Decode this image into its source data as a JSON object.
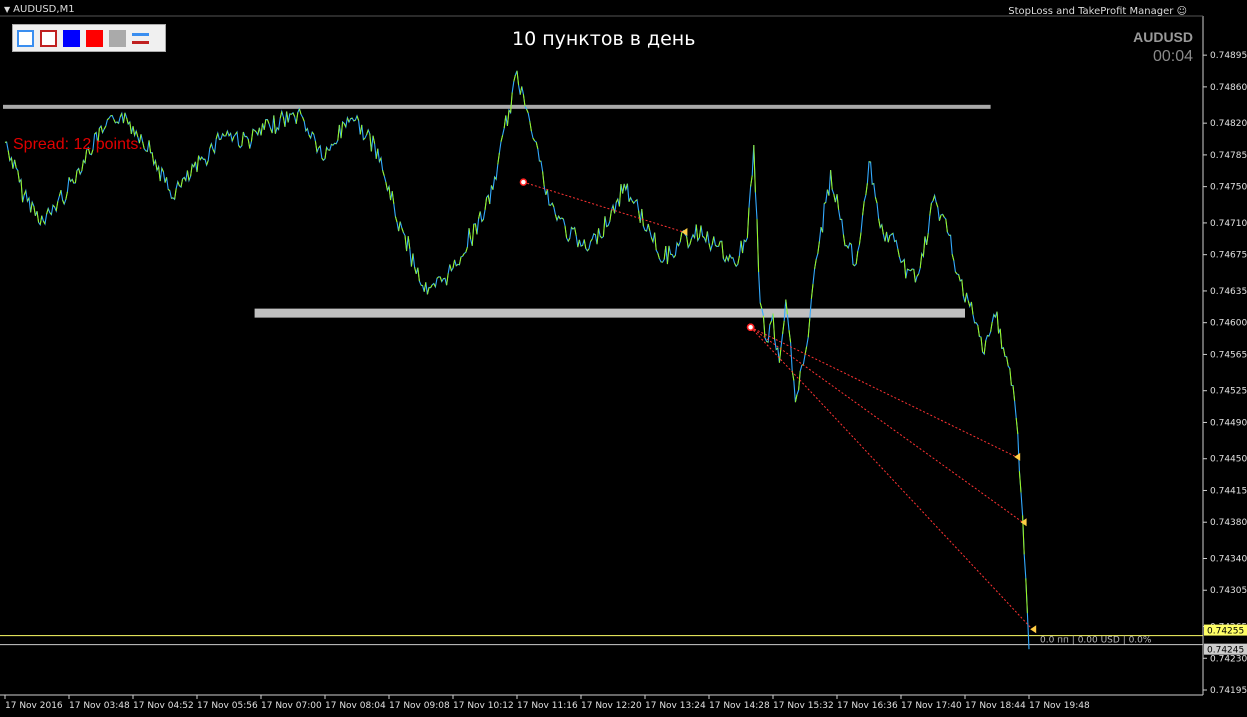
{
  "window": {
    "title": "AUDUSD,M1",
    "plugin_label": "StopLoss and TakeProfit Manager"
  },
  "overlay": {
    "headline": "10 пунктов в день",
    "symbol": "AUDUSD",
    "timer": "00:04",
    "spread_label": "Spread: 12 points.",
    "position_info": "0.0 пп | 0.00 USD | 0.0%"
  },
  "toolbar": {
    "buttons": [
      {
        "name": "blue-outline-square-button",
        "color": "#3a8ef0"
      },
      {
        "name": "red-outline-square-button",
        "color": "#c02020"
      },
      {
        "name": "blue-filled-square-button",
        "color": "#0000ff"
      },
      {
        "name": "red-filled-square-button",
        "color": "#ff0000"
      },
      {
        "name": "gray-filled-square-button",
        "color": "#aaaaaa"
      },
      {
        "name": "lines-icon-button",
        "color": "#3a8ef0"
      }
    ]
  },
  "chart_data": {
    "type": "line",
    "title": "",
    "xlabel": "",
    "ylabel": "",
    "ylim": [
      0.74195,
      0.74915
    ],
    "x_ticks": [
      "17 Nov 2016",
      "17 Nov 03:48",
      "17 Nov 04:52",
      "17 Nov 05:56",
      "17 Nov 07:00",
      "17 Nov 08:04",
      "17 Nov 09:08",
      "17 Nov 10:12",
      "17 Nov 11:16",
      "17 Nov 12:20",
      "17 Nov 13:24",
      "17 Nov 14:28",
      "17 Nov 15:32",
      "17 Nov 16:36",
      "17 Nov 17:40",
      "17 Nov 18:44",
      "17 Nov 19:48"
    ],
    "y_ticks": [
      "0.74895",
      "0.74860",
      "0.74820",
      "0.74785",
      "0.74750",
      "0.74710",
      "0.74675",
      "0.74635",
      "0.74600",
      "0.74565",
      "0.74525",
      "0.74490",
      "0.74450",
      "0.74415",
      "0.74380",
      "0.74340",
      "0.74305",
      "0.74265",
      "0.74230",
      "0.74195"
    ],
    "y_tick_values": [
      0.74895,
      0.7486,
      0.7482,
      0.74785,
      0.7475,
      0.7471,
      0.74675,
      0.74635,
      0.746,
      0.74565,
      0.74525,
      0.7449,
      0.7445,
      0.74415,
      0.7438,
      0.7434,
      0.74305,
      0.74265,
      0.7423,
      0.74195
    ],
    "series": [
      {
        "color": "#33aaff",
        "highlight_color": "#aaff00",
        "x": [
          0,
          0.3,
          0.6,
          1.0,
          1.4,
          1.8,
          2.2,
          2.6,
          3.0,
          3.4,
          3.8,
          4.2,
          4.6,
          5.0,
          5.4,
          5.8,
          6.2,
          6.6,
          7.0,
          7.4,
          7.6,
          7.8,
          8.0,
          8.2,
          8.5,
          8.8,
          9.1,
          9.4,
          9.7,
          10.0,
          10.3,
          10.6,
          10.9,
          11.2,
          11.4,
          11.6,
          11.7,
          11.8,
          11.9,
          12.0,
          12.1,
          12.2,
          12.35,
          12.5,
          12.7,
          12.9,
          13.1,
          13.3,
          13.5,
          13.7,
          13.9,
          14.1,
          14.3,
          14.5,
          14.7,
          14.9,
          15.1,
          15.3,
          15.4,
          15.5,
          15.6,
          15.7,
          15.8,
          15.9,
          16.0
        ],
        "values": [
          0.748,
          0.7474,
          0.7471,
          0.7475,
          0.748,
          0.7483,
          0.748,
          0.7474,
          0.7477,
          0.7481,
          0.748,
          0.7482,
          0.7483,
          0.7478,
          0.7483,
          0.7479,
          0.747,
          0.7463,
          0.7466,
          0.7471,
          0.7474,
          0.7481,
          0.7487,
          0.7483,
          0.7473,
          0.747,
          0.7468,
          0.7471,
          0.7475,
          0.7471,
          0.7467,
          0.7469,
          0.747,
          0.7468,
          0.7466,
          0.747,
          0.7479,
          0.7462,
          0.7458,
          0.746,
          0.7455,
          0.7462,
          0.7452,
          0.7456,
          0.7468,
          0.7476,
          0.747,
          0.7466,
          0.7478,
          0.747,
          0.7469,
          0.7465,
          0.7466,
          0.7473,
          0.7471,
          0.7465,
          0.7461,
          0.7457,
          0.7459,
          0.7461,
          0.7457,
          0.7455,
          0.745,
          0.7438,
          0.7424
        ]
      }
    ],
    "horizontal_levels": [
      {
        "value": 0.74838,
        "color": "#a9a9a9",
        "kind": "resistance-zone",
        "x_end": 15.4
      },
      {
        "value": 0.7461,
        "color": "#c0c0c0",
        "kind": "support-zone",
        "x_start": 3.9,
        "x_end": 15.0
      },
      {
        "value": 0.74255,
        "color": "#ffff66",
        "kind": "bid-line"
      },
      {
        "value": 0.74245,
        "color": "#cccccc",
        "kind": "ask-line"
      }
    ],
    "current_price_tags": [
      "0.74255",
      "0.74245"
    ],
    "trade_lines": [
      {
        "from": [
          8.1,
          0.74755
        ],
        "to": [
          10.6,
          0.747
        ],
        "color": "#ff3333"
      },
      {
        "from": [
          11.65,
          0.74595
        ],
        "to": [
          15.8,
          0.74452
        ],
        "color": "#ff3333"
      },
      {
        "from": [
          11.65,
          0.74595
        ],
        "to": [
          15.9,
          0.7438
        ],
        "color": "#ff3333"
      },
      {
        "from": [
          11.65,
          0.74595
        ],
        "to": [
          16.05,
          0.74262
        ],
        "color": "#ff3333"
      }
    ]
  }
}
